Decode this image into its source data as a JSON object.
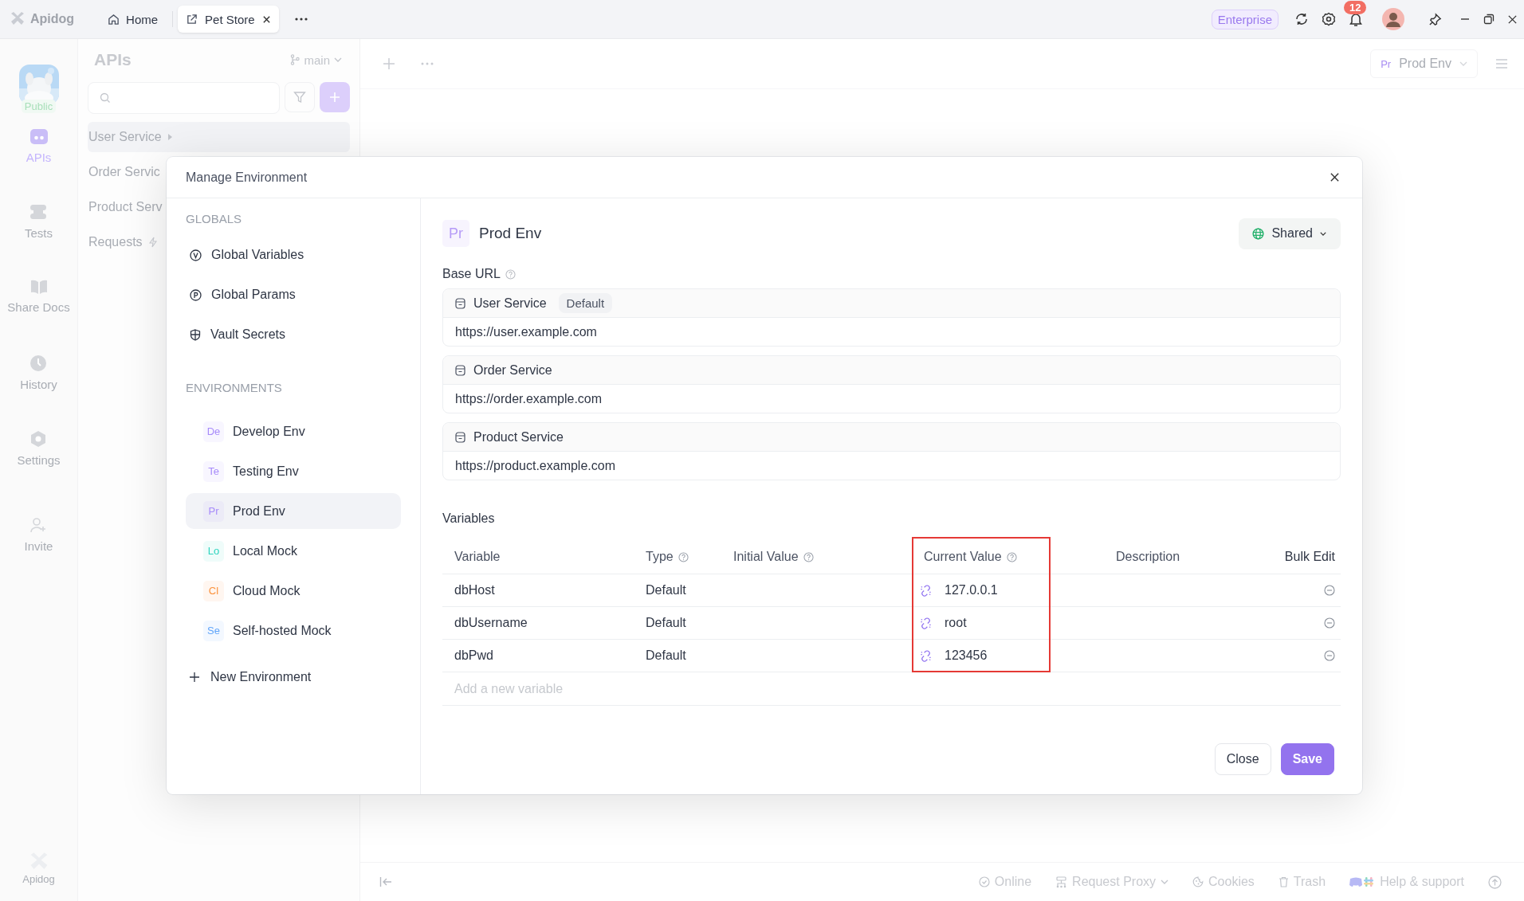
{
  "titlebar": {
    "app_name": "Apidog",
    "tabs": [
      {
        "label": "Home",
        "kind": "home",
        "selected": false
      },
      {
        "label": "Pet Store",
        "kind": "project",
        "selected": true
      }
    ],
    "plan_badge": "Enterprise",
    "notifications": "12"
  },
  "rail": {
    "avatar_label": "Public",
    "items": [
      {
        "label": "APIs",
        "kind": "apis",
        "selected": true
      },
      {
        "label": "Tests",
        "kind": "tests",
        "selected": false
      },
      {
        "label": "Share Docs",
        "kind": "docs",
        "selected": false
      },
      {
        "label": "History",
        "kind": "history",
        "selected": false
      },
      {
        "label": "Settings",
        "kind": "settings",
        "selected": false
      },
      {
        "label": "Invite",
        "kind": "invite",
        "selected": false
      }
    ],
    "footer": "Apidog"
  },
  "apis_panel": {
    "title": "APIs",
    "branch": "main",
    "tree": [
      {
        "label": "User Service",
        "kind": "group"
      },
      {
        "label": "Order Servic",
        "kind": "item"
      },
      {
        "label": "Product Serv",
        "kind": "item"
      },
      {
        "label": "Requests",
        "kind": "requests"
      }
    ]
  },
  "workspace": {
    "env_selector": {
      "badge": "Pr",
      "label": "Prod Env"
    }
  },
  "modal": {
    "title": "Manage Environment",
    "globals_heading": "GLOBALS",
    "globals": [
      {
        "label": "Global Variables",
        "kind": "variables"
      },
      {
        "label": "Global Params",
        "kind": "params"
      },
      {
        "label": "Vault Secrets",
        "kind": "vault"
      }
    ],
    "environments_heading": "ENVIRONMENTS",
    "environments": [
      {
        "badge": "De",
        "label": "Develop Env",
        "color": "#a78bfa",
        "selected": false
      },
      {
        "badge": "Te",
        "label": "Testing Env",
        "color": "#a78bfa",
        "selected": false
      },
      {
        "badge": "Pr",
        "label": "Prod Env",
        "color": "#a78bfa",
        "selected": true
      },
      {
        "badge": "Lo",
        "label": "Local Mock",
        "color": "#2dd4bf",
        "selected": false
      },
      {
        "badge": "Cl",
        "label": "Cloud Mock",
        "color": "#fb923c",
        "selected": false
      },
      {
        "badge": "Se",
        "label": "Self-hosted Mock",
        "color": "#60a5fa",
        "selected": false
      }
    ],
    "new_environment": "New Environment",
    "detail": {
      "badge": "Pr",
      "name": "Prod Env",
      "scope": "Shared",
      "base_url_label": "Base URL",
      "services": [
        {
          "name": "User Service",
          "tag": "Default",
          "url": "https://user.example.com"
        },
        {
          "name": "Order Service",
          "url": "https://order.example.com"
        },
        {
          "name": "Product Service",
          "url": "https://product.example.com"
        }
      ],
      "variables_label": "Variables",
      "columns": [
        {
          "label": "Variable",
          "help": false,
          "highlighted": false
        },
        {
          "label": "Type",
          "help": true,
          "highlighted": false
        },
        {
          "label": "Initial Value",
          "help": true,
          "highlighted": false
        },
        {
          "label": "Current Value",
          "help": true,
          "highlighted": true
        },
        {
          "label": "Description",
          "help": false,
          "highlighted": false
        }
      ],
      "bulk_edit": "Bulk Edit",
      "rows": [
        {
          "variable": "dbHost",
          "type": "Default",
          "current_value": "127.0.0.1"
        },
        {
          "variable": "dbUsername",
          "type": "Default",
          "current_value": "root"
        },
        {
          "variable": "dbPwd",
          "type": "Default",
          "current_value": "123456"
        }
      ],
      "add_placeholder": "Add a new variable"
    },
    "buttons": [
      {
        "label": "Close",
        "kind": "secondary"
      },
      {
        "label": "Save",
        "kind": "primary"
      }
    ]
  },
  "status_bar": {
    "items": [
      {
        "label": "Online",
        "kind": "online"
      },
      {
        "label": "Request Proxy",
        "kind": "proxy"
      },
      {
        "label": "Cookies",
        "kind": "cookies"
      },
      {
        "label": "Trash",
        "kind": "trash"
      },
      {
        "label": "Help & support",
        "kind": "help"
      }
    ]
  }
}
